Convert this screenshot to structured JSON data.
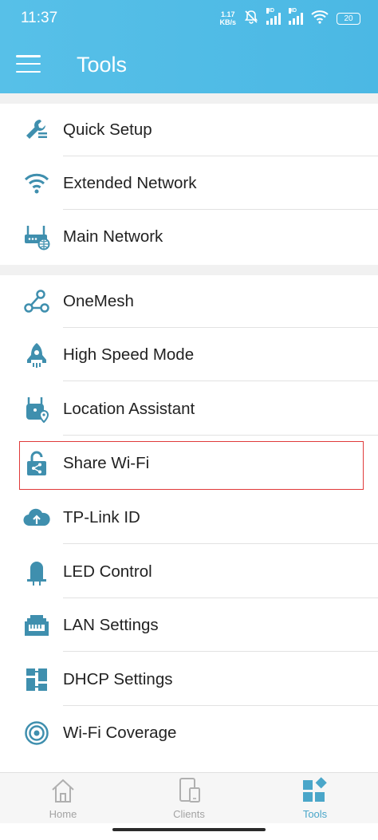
{
  "status_bar": {
    "time": "11:37",
    "net_speed_value": "1.17",
    "net_speed_unit": "KB/s",
    "hd1": "HD",
    "hd2": "HD",
    "battery": "20"
  },
  "header": {
    "title": "Tools",
    "background_color": "#4bb8e4"
  },
  "sections": [
    {
      "items": [
        {
          "label": "Quick Setup",
          "icon": "wrench-icon"
        },
        {
          "label": "Extended Network",
          "icon": "wifi-icon"
        },
        {
          "label": "Main Network",
          "icon": "router-globe-icon"
        }
      ]
    },
    {
      "items": [
        {
          "label": "OneMesh",
          "icon": "mesh-icon"
        },
        {
          "label": "High Speed Mode",
          "icon": "rocket-icon"
        },
        {
          "label": "Location Assistant",
          "icon": "extender-location-icon"
        },
        {
          "label": "Share Wi-Fi",
          "icon": "share-lock-icon",
          "highlighted": true
        },
        {
          "label": "TP-Link ID",
          "icon": "cloud-upload-icon"
        },
        {
          "label": "LED Control",
          "icon": "led-icon"
        },
        {
          "label": "LAN Settings",
          "icon": "ethernet-port-icon"
        },
        {
          "label": "DHCP Settings",
          "icon": "dhcp-icon"
        },
        {
          "label": "Wi-Fi Coverage",
          "icon": "coverage-icon"
        }
      ]
    }
  ],
  "tabs": [
    {
      "label": "Home",
      "icon": "home-icon",
      "active": false
    },
    {
      "label": "Clients",
      "icon": "devices-icon",
      "active": false
    },
    {
      "label": "Tools",
      "icon": "tools-grid-icon",
      "active": true
    }
  ],
  "colors": {
    "accent": "#4aa6c9",
    "icon": "#3f8fae",
    "highlight_border": "#e03a3a"
  }
}
